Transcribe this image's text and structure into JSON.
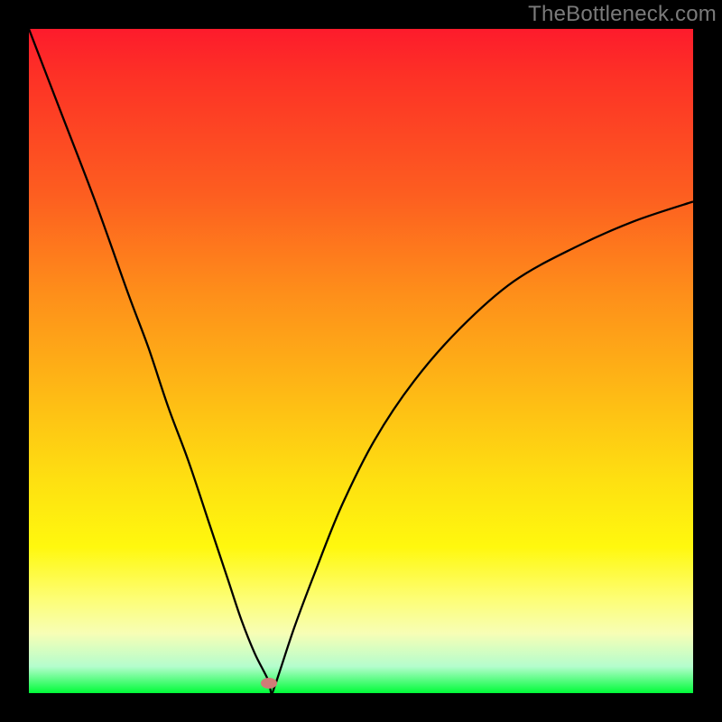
{
  "watermark": "TheBottleneck.com",
  "chart_data": {
    "type": "line",
    "title": "",
    "xlabel": "",
    "ylabel": "",
    "xlim": [
      0,
      100
    ],
    "ylim": [
      0,
      100
    ],
    "yaxis_inverted_meaning": "lower_is_better",
    "background_gradient_stops": [
      {
        "pos": 0,
        "color": "#fd1b2c"
      },
      {
        "pos": 25,
        "color": "#fd5e20"
      },
      {
        "pos": 55,
        "color": "#feba15"
      },
      {
        "pos": 78,
        "color": "#fff80e"
      },
      {
        "pos": 91,
        "color": "#f7feb5"
      },
      {
        "pos": 100,
        "color": "#00fc39"
      }
    ],
    "series": [
      {
        "name": "bottleneck-curve",
        "x": [
          0,
          5,
          10,
          15,
          18,
          21,
          24,
          27,
          30,
          32,
          34,
          36,
          36.5,
          37,
          38,
          40,
          43,
          47,
          52,
          58,
          65,
          73,
          82,
          91,
          100
        ],
        "y": [
          100,
          87,
          74,
          60,
          52,
          43,
          35,
          26,
          17,
          11,
          6,
          2,
          0,
          1,
          4,
          10,
          18,
          28,
          38,
          47,
          55,
          62,
          67,
          71,
          74
        ]
      }
    ],
    "marker": {
      "x": 36.2,
      "y": 1.5,
      "color": "#d07c77"
    }
  }
}
